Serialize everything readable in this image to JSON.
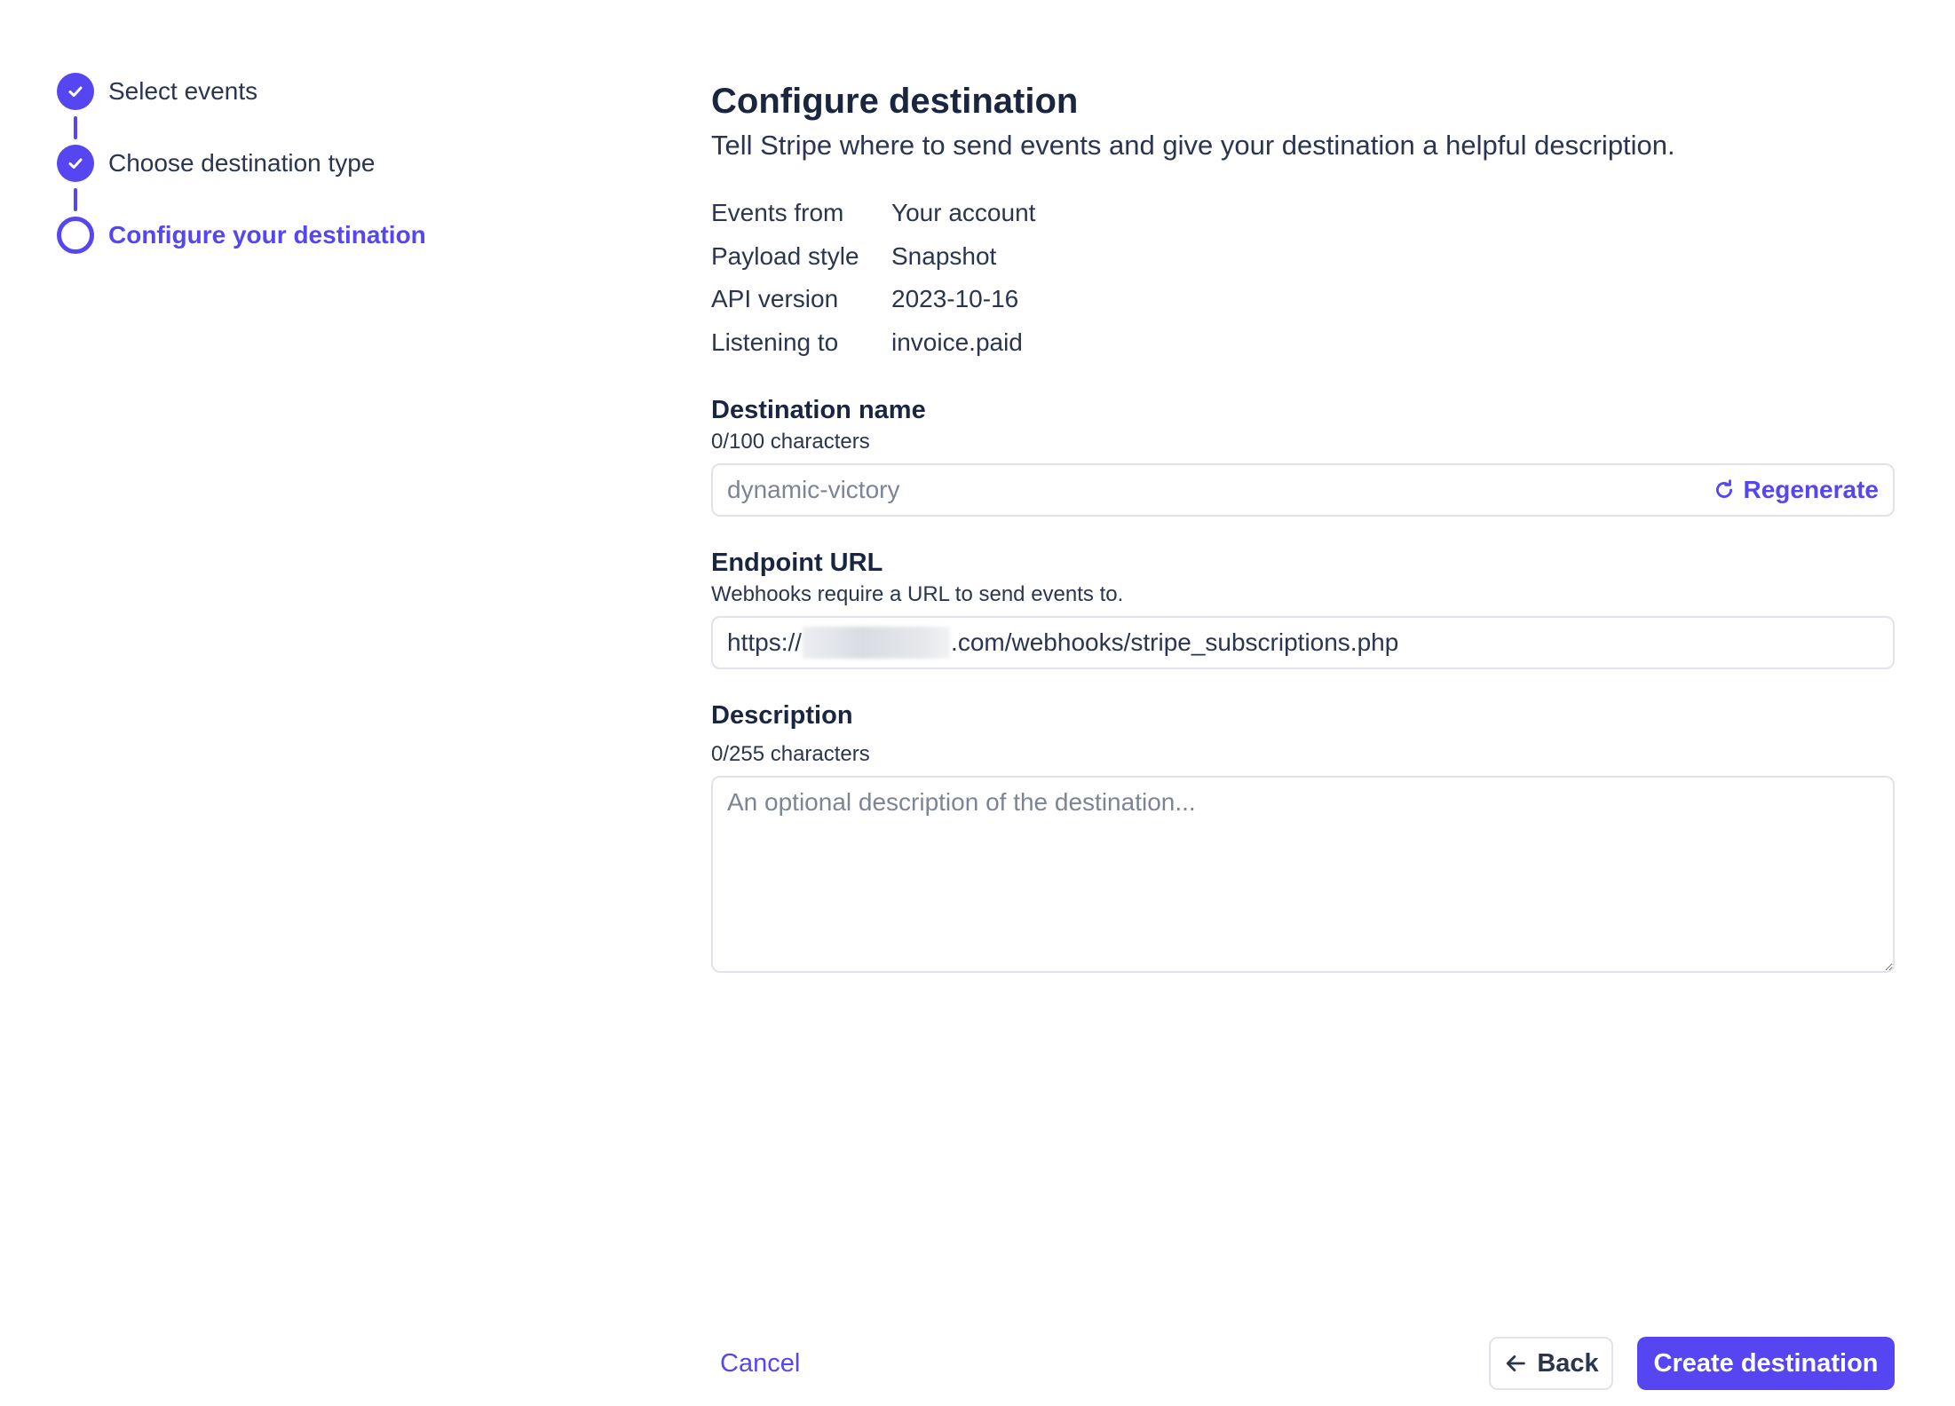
{
  "stepper": {
    "steps": [
      {
        "label": "Select events",
        "state": "done"
      },
      {
        "label": "Choose destination type",
        "state": "done"
      },
      {
        "label": "Configure your destination",
        "state": "current"
      }
    ]
  },
  "header": {
    "title": "Configure destination",
    "subtitle": "Tell Stripe where to send events and give your destination a helpful description."
  },
  "summary": {
    "rows": [
      {
        "key": "Events from",
        "value": "Your account"
      },
      {
        "key": "Payload style",
        "value": "Snapshot"
      },
      {
        "key": "API version",
        "value": "2023-10-16"
      },
      {
        "key": "Listening to",
        "value": "invoice.paid"
      }
    ]
  },
  "destination_name": {
    "label": "Destination name",
    "hint": "0/100 characters",
    "value": "",
    "placeholder": "dynamic-victory",
    "regenerate_label": "Regenerate"
  },
  "endpoint_url": {
    "label": "Endpoint URL",
    "hint": "Webhooks require a URL to send events to.",
    "value_prefix": "https://",
    "value_suffix": ".com/webhooks/stripe_subscriptions.php"
  },
  "description": {
    "label": "Description",
    "hint": "0/255 characters",
    "placeholder": "An optional description of the destination..."
  },
  "footer": {
    "cancel_label": "Cancel",
    "back_label": "Back",
    "create_label": "Create destination"
  },
  "colors": {
    "accent": "#5546f2",
    "text": "#1a2540",
    "border": "#dfe3ea"
  }
}
